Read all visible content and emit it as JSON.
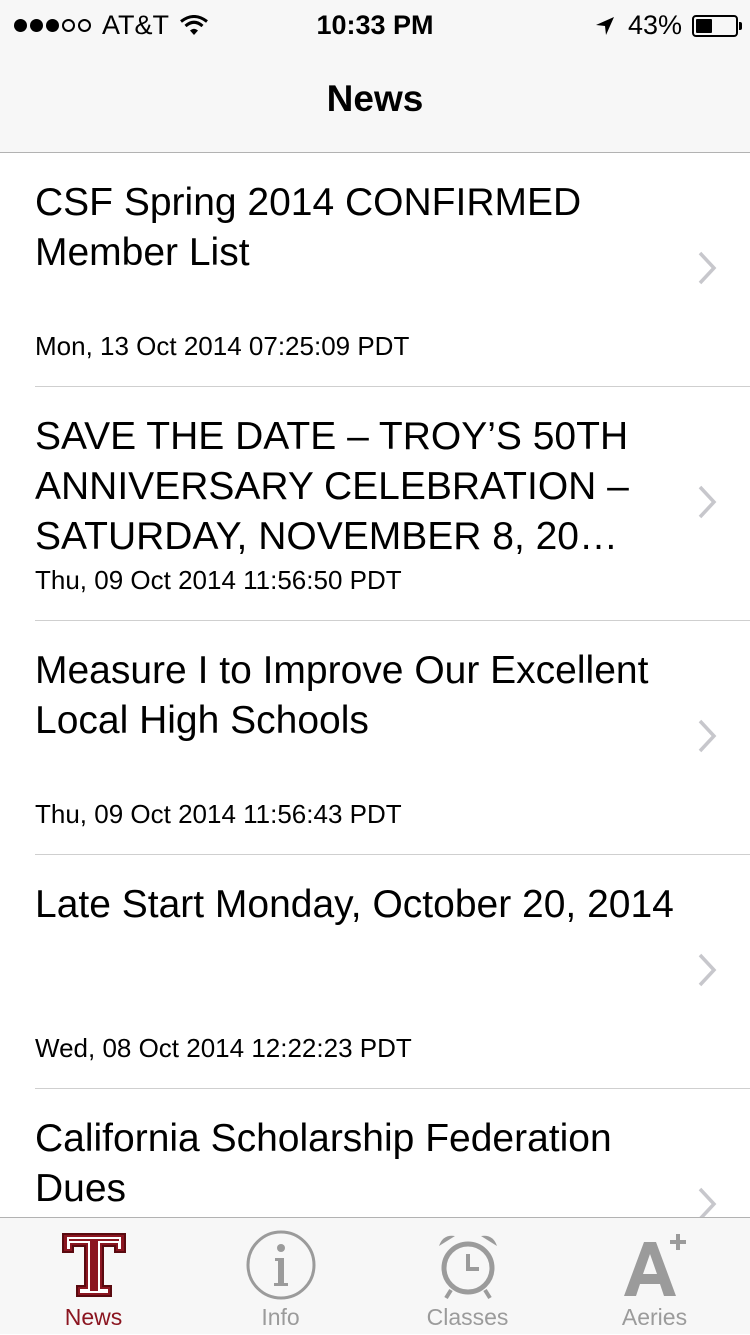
{
  "status_bar": {
    "carrier": "AT&T",
    "time": "10:33 PM",
    "battery_percent": "43%",
    "battery_level": 0.43,
    "signal_bars": 3,
    "signal_total": 5
  },
  "nav": {
    "title": "News"
  },
  "news_items": [
    {
      "headline": "CSF Spring 2014 CONFIRMED Member List",
      "date": "Mon, 13 Oct 2014 07:25:09 PDT"
    },
    {
      "headline": "SAVE THE DATE – TROY’S 50TH ANNIVERSARY CELEBRATION – SATURDAY, NOVEMBER 8, 20…",
      "date": "Thu, 09 Oct 2014 11:56:50 PDT"
    },
    {
      "headline": "Measure I to Improve Our Excellent Local High Schools",
      "date": "Thu, 09 Oct 2014 11:56:43 PDT"
    },
    {
      "headline": "Late Start Monday, October 20, 2014",
      "date": "Wed, 08 Oct 2014 12:22:23 PDT"
    },
    {
      "headline": "California Scholarship Federation Dues",
      "date": ""
    }
  ],
  "tabs": [
    {
      "label": "News",
      "icon": "troy-t-logo-icon",
      "active": true
    },
    {
      "label": "Info",
      "icon": "info-icon",
      "active": false
    },
    {
      "label": "Classes",
      "icon": "alarm-clock-icon",
      "active": false
    },
    {
      "label": "Aeries",
      "icon": "a-plus-icon",
      "active": false
    }
  ],
  "colors": {
    "accent": "#8b1520",
    "inactive": "#9b9b9b",
    "bar_bg": "#f7f7f7"
  }
}
